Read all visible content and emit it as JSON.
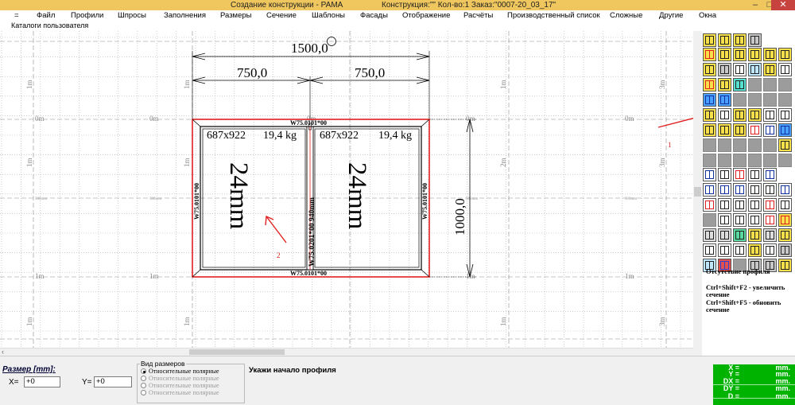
{
  "window": {
    "title": "Создание конструкции - РАМА",
    "construction": "Конструкция:\"\" Кол-во:1  Заказ:\"0007-20_03_17\""
  },
  "menu": [
    "=",
    "Файл",
    "Профили",
    "Шпросы",
    "Заполнения",
    "Размеры",
    "Сечение",
    "Шаблоны",
    "Фасады",
    "Отображение",
    "Расчёты",
    "Производственный список",
    "Сложные",
    "Другие",
    "Окна"
  ],
  "catalogs": "Каталоги пользователя",
  "drawing": {
    "dim_total": "1500,0",
    "dim_left": "750,0",
    "dim_right": "750,0",
    "dim_height": "1000,0",
    "profile_top": "W75.0101*00",
    "profile_bottom": "W75.0101*00",
    "profile_left": "W75.0101*00",
    "profile_right": "W75.0101*00",
    "profile_mullion": "W75.0201*00  940mm",
    "left_sash": {
      "size": "687x922",
      "weight": "19,4 kg",
      "glass": "24mm"
    },
    "right_sash": {
      "size": "687x922",
      "weight": "19,4 kg",
      "glass": "24mm"
    },
    "annotation_1": "1",
    "annotation_2": "2",
    "grid_labels": {
      "zero": "0m",
      "one": "1m",
      "two": "2m",
      "three": "3m",
      "mm500": "500mm"
    }
  },
  "info": {
    "line1": "Отсутствие профиля",
    "line2": "Ctrl+Shift+F2 - увеличить сечение",
    "line3": "Ctrl+Shift+F5 - обновить сечение"
  },
  "bottom": {
    "size_label": "Размер [mm]:",
    "x_label": "X=",
    "x_value": "+0",
    "y_label": "Y=",
    "y_value": "+0",
    "view_group": "Вид размеров",
    "radio_1": "Относительные полярные",
    "radio_2": "Относительные полярные",
    "radio_3": "Относительные полярные",
    "radio_4": "Относительные полярные",
    "prompt": "Укажи начало профиля"
  },
  "coords": {
    "x": "X =",
    "y": "Y =",
    "dx": "DX =",
    "dy": "DY =",
    "d": "D =",
    "unit": "mm."
  },
  "colors": {
    "title_bar": "#f0c75e",
    "frame_red": "#e02020",
    "coord_panel": "#00b300"
  }
}
